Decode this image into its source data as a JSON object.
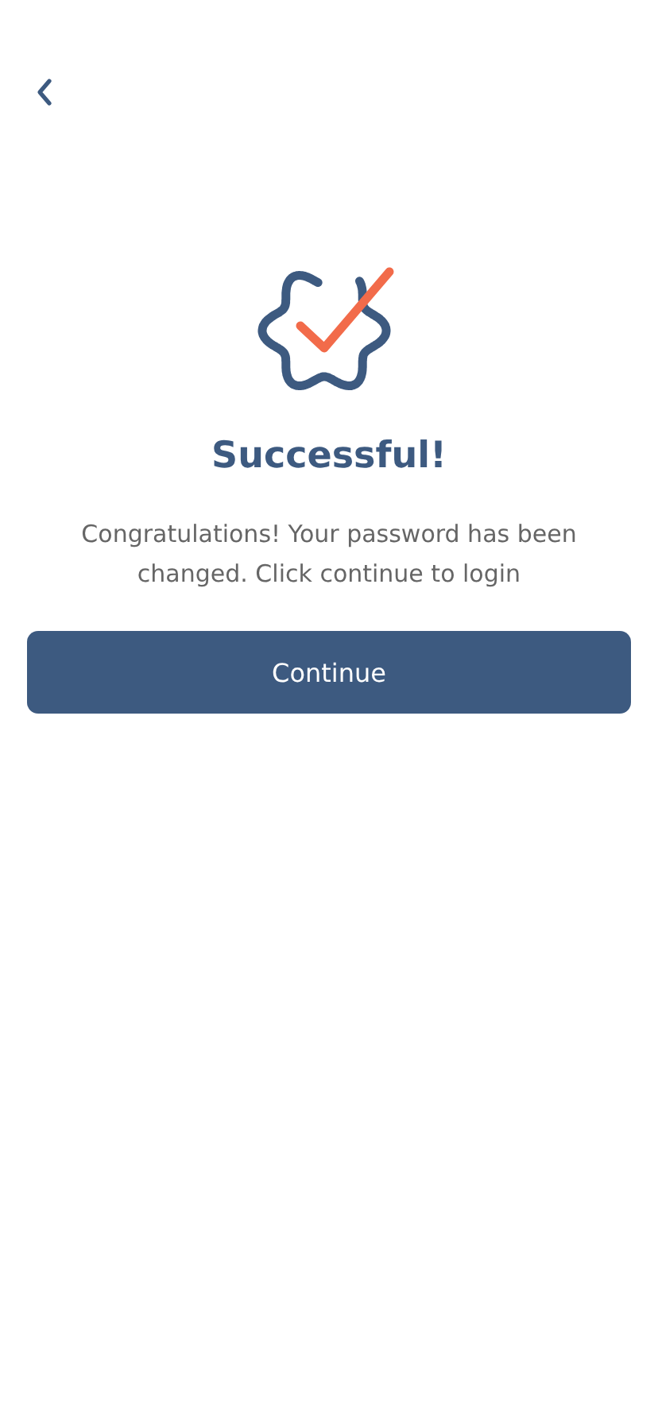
{
  "title": "Successful!",
  "message": "Congratulations! Your password has been changed. Click continue to login",
  "button": {
    "label": "Continue"
  }
}
